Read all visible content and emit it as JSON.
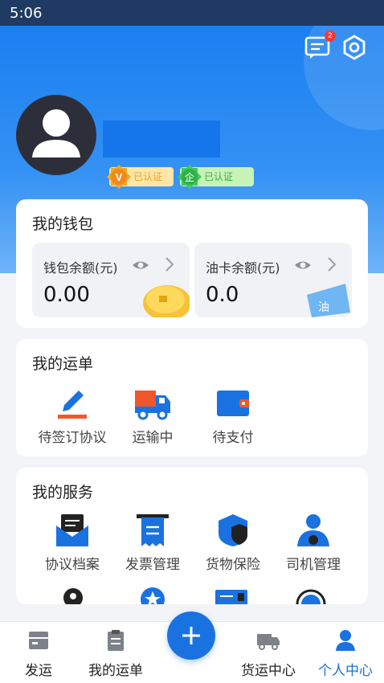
{
  "status": {
    "time": "5:06"
  },
  "header": {
    "message_badge": "2"
  },
  "user": {
    "cert_personal": "已认证",
    "cert_personal_icon": "V",
    "cert_enterprise": "已认证",
    "cert_enterprise_icon": "企"
  },
  "wallet": {
    "title": "我的钱包",
    "balance_label": "钱包余额(元)",
    "balance_value": "0.00",
    "fuel_label": "油卡余额(元)",
    "fuel_value": "0.0",
    "fuel_card_text": "油"
  },
  "orders": {
    "title": "我的运单",
    "items": [
      {
        "label": "待签订协议",
        "icon": "pen-icon"
      },
      {
        "label": "运输中",
        "icon": "truck-icon"
      },
      {
        "label": "待支付",
        "icon": "wallet-icon"
      }
    ]
  },
  "services": {
    "title": "我的服务",
    "items": [
      {
        "label": "协议档案",
        "icon": "mail-icon"
      },
      {
        "label": "发票管理",
        "icon": "receipt-icon"
      },
      {
        "label": "货物保险",
        "icon": "shield-icon"
      },
      {
        "label": "司机管理",
        "icon": "driver-icon"
      }
    ]
  },
  "tabbar": {
    "items": [
      {
        "label": "发运",
        "icon": "box-icon"
      },
      {
        "label": "我的运单",
        "icon": "clipboard-icon"
      },
      {
        "label": "货运中心",
        "icon": "truck-icon"
      },
      {
        "label": "个人中心",
        "icon": "user-icon"
      }
    ],
    "active": "个人中心"
  },
  "colors": {
    "primary": "#1a72e0",
    "badge": "#f23a3a",
    "gold": "#f0a020",
    "green": "#33b04a"
  }
}
